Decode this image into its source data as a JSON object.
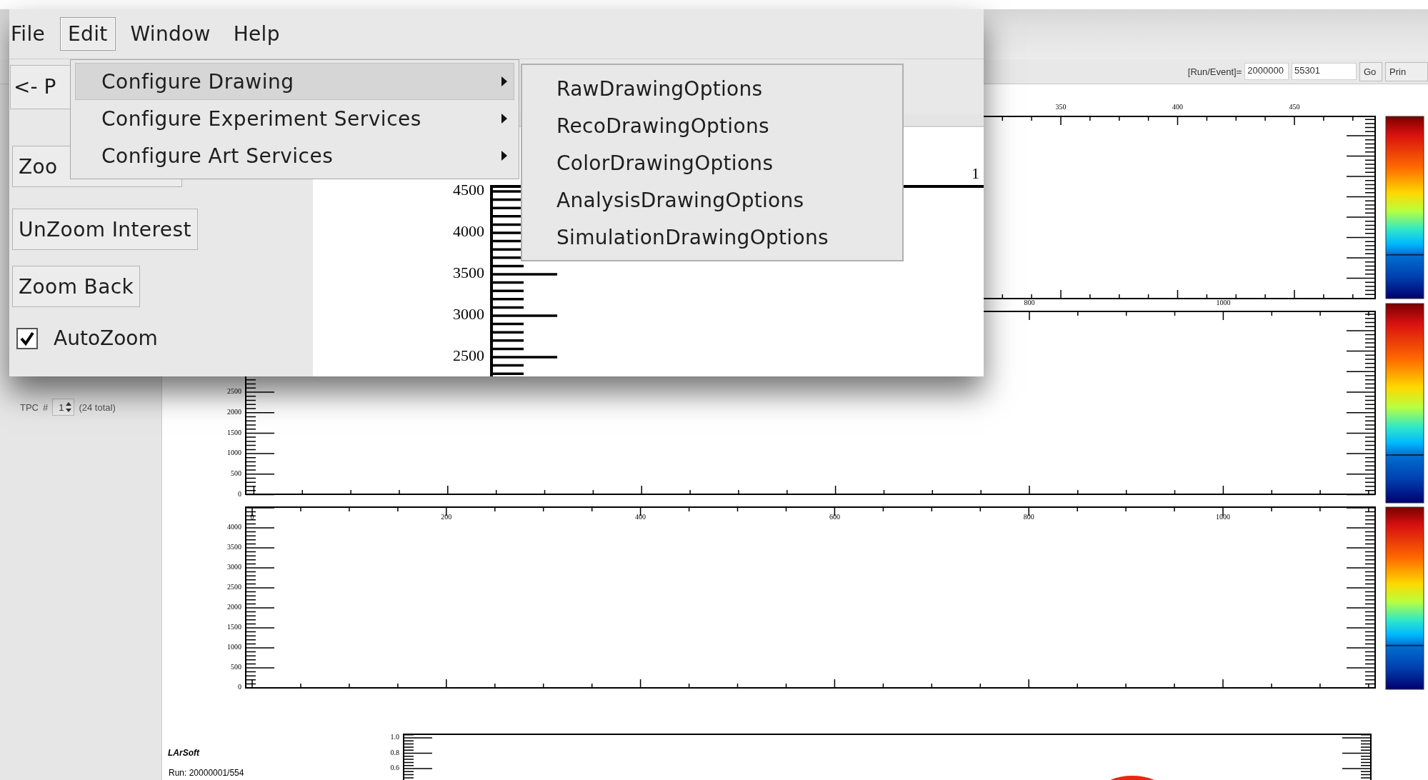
{
  "window": {
    "menu": [
      {
        "label": "File",
        "selected": false
      },
      {
        "label": "Edit",
        "selected": true
      },
      {
        "label": "Window",
        "selected": false
      },
      {
        "label": "Help",
        "selected": false
      }
    ],
    "edit_menu": [
      {
        "label": "Configure Drawing",
        "selected": true,
        "has_submenu": true
      },
      {
        "label": "Configure Experiment Services",
        "selected": false,
        "has_submenu": true
      },
      {
        "label": "Configure Art Services",
        "selected": false,
        "has_submenu": true
      }
    ],
    "submenu": [
      "RawDrawingOptions",
      "RecoDrawingOptions",
      "ColorDrawingOptions",
      "AnalysisDrawingOptions",
      "SimulationDrawingOptions"
    ],
    "toolbar": {
      "back_button": "<- P"
    },
    "controls": {
      "buttons": [
        "Zoo",
        "UnZoom Interest",
        "Zoom Back"
      ],
      "autozoom": {
        "label": "AutoZoom",
        "checked": true
      }
    },
    "plot": {
      "edge_label": "1",
      "y_labels": [
        "4500",
        "4000",
        "3500",
        "3000",
        "2500"
      ]
    }
  },
  "background": {
    "toolbar": {
      "label": "[Run/Event]=",
      "run": "2000000",
      "event": "55301",
      "buttons": [
        "Go",
        "Prin"
      ]
    },
    "tpc": {
      "label": "TPC",
      "hash": "#",
      "value": "1",
      "total": "(24 total)"
    },
    "plots": [
      {
        "x_labels": [
          "350",
          "400",
          "450"
        ]
      },
      {
        "x_labels": [
          "800",
          "1000"
        ],
        "y_labels": [
          "2500",
          "2000",
          "1500",
          "1000",
          "500",
          "0"
        ]
      },
      {
        "x_labels": [
          "0",
          "200",
          "400",
          "600",
          "800",
          "1000"
        ],
        "y_labels": [
          "4000",
          "3500",
          "3000",
          "2500",
          "2000",
          "1500",
          "1000",
          "500",
          "0"
        ]
      },
      {
        "y_labels": [
          "1.0",
          "0.8",
          "0.6"
        ]
      }
    ],
    "footer": {
      "title": "LArSoft",
      "run": "Run: 20000001/554"
    }
  }
}
